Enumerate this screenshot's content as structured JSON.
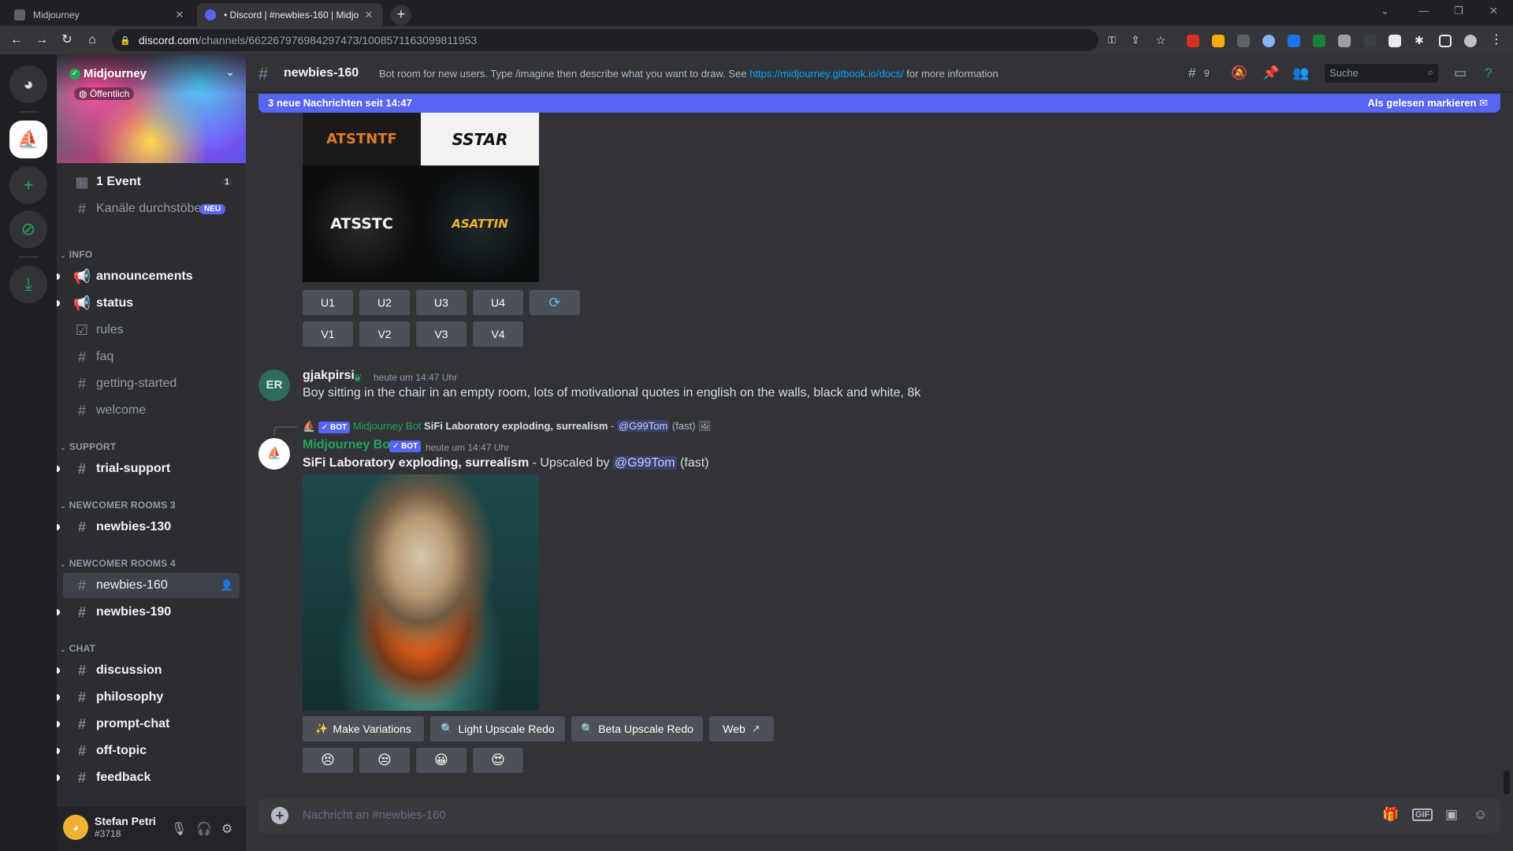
{
  "browser": {
    "tabs": [
      {
        "title": "Midjourney",
        "active": false
      },
      {
        "title": "• Discord | #newbies-160 | Midjo",
        "active": true
      }
    ],
    "url_host": "discord.com",
    "url_path": "/channels/662267976984297473/1008571163099811953"
  },
  "server": {
    "name": "Midjourney",
    "visibility": "Öffentlich"
  },
  "sidebar": {
    "event_label": "1 Event",
    "event_count": "1",
    "browse_label": "Kanäle durchstöbern",
    "browse_badge": "NEU",
    "categories": {
      "info": "INFO",
      "support": "SUPPORT",
      "newcomer3": "NEWCOMER ROOMS 3",
      "newcomer4": "NEWCOMER ROOMS 4",
      "chat": "CHAT"
    },
    "channels": {
      "announcements": "announcements",
      "status": "status",
      "rules": "rules",
      "faq": "faq",
      "getting_started": "getting-started",
      "welcome": "welcome",
      "trial_support": "trial-support",
      "newbies130": "newbies-130",
      "newbies160": "newbies-160",
      "newbies190": "newbies-190",
      "discussion": "discussion",
      "philosophy": "philosophy",
      "prompt_chat": "prompt-chat",
      "off_topic": "off-topic",
      "feedback": "feedback"
    }
  },
  "user": {
    "name": "Stefan Petri",
    "tag": "#3718"
  },
  "header": {
    "channel": "newbies-160",
    "topic_prefix": "Bot room for new users. Type /imagine then describe what you want to draw. See ",
    "topic_link": "https://midjourney.gitbook.io/docs/",
    "topic_suffix": " for more information",
    "thread_count": "9",
    "search_placeholder": "Suche"
  },
  "new_messages": {
    "label": "3 neue Nachrichten seit 14:47",
    "mark_read": "Als gelesen markieren"
  },
  "grid_image": {
    "tiles": [
      "ATSTNTF",
      "SSTAR",
      "ATSSTC",
      "ASATTIN"
    ]
  },
  "grid_buttons": {
    "upscale": [
      "U1",
      "U2",
      "U3",
      "U4"
    ],
    "variation": [
      "V1",
      "V2",
      "V3",
      "V4"
    ]
  },
  "messages": [
    {
      "author": "gjakpirsi",
      "avatar": "ER",
      "time": "heute um 14:47 Uhr",
      "text": "Boy sitting in the chair in an empty room, lots of motivational quotes in english on the walls, black and white, 8k"
    },
    {
      "author": "Midjourney Bot",
      "badge": "✓ BOT",
      "time": "heute um 14:47 Uhr",
      "reply_author": "Midjourney Bot",
      "reply_prompt": "SiFi Laboratory exploding, surrealism",
      "reply_mention": "@G99Tom",
      "reply_speed": "(fast)",
      "prompt": "SiFi Laboratory exploding, surrealism",
      "upscaled_by": " - Upscaled by ",
      "mention": "@G99Tom",
      "speed": "(fast)"
    }
  ],
  "upscale_buttons": {
    "make_variations": "Make Variations",
    "light_redo": "Light Upscale Redo",
    "beta_redo": "Beta Upscale Redo",
    "web": "Web"
  },
  "reactions": [
    "😣",
    "😒",
    "😀",
    "😍"
  ],
  "composer": {
    "placeholder": "Nachricht an #newbies-160"
  },
  "colors": {
    "blurple": "#5865f2",
    "bot_name": "#23a55a",
    "link": "#00a8fc"
  }
}
